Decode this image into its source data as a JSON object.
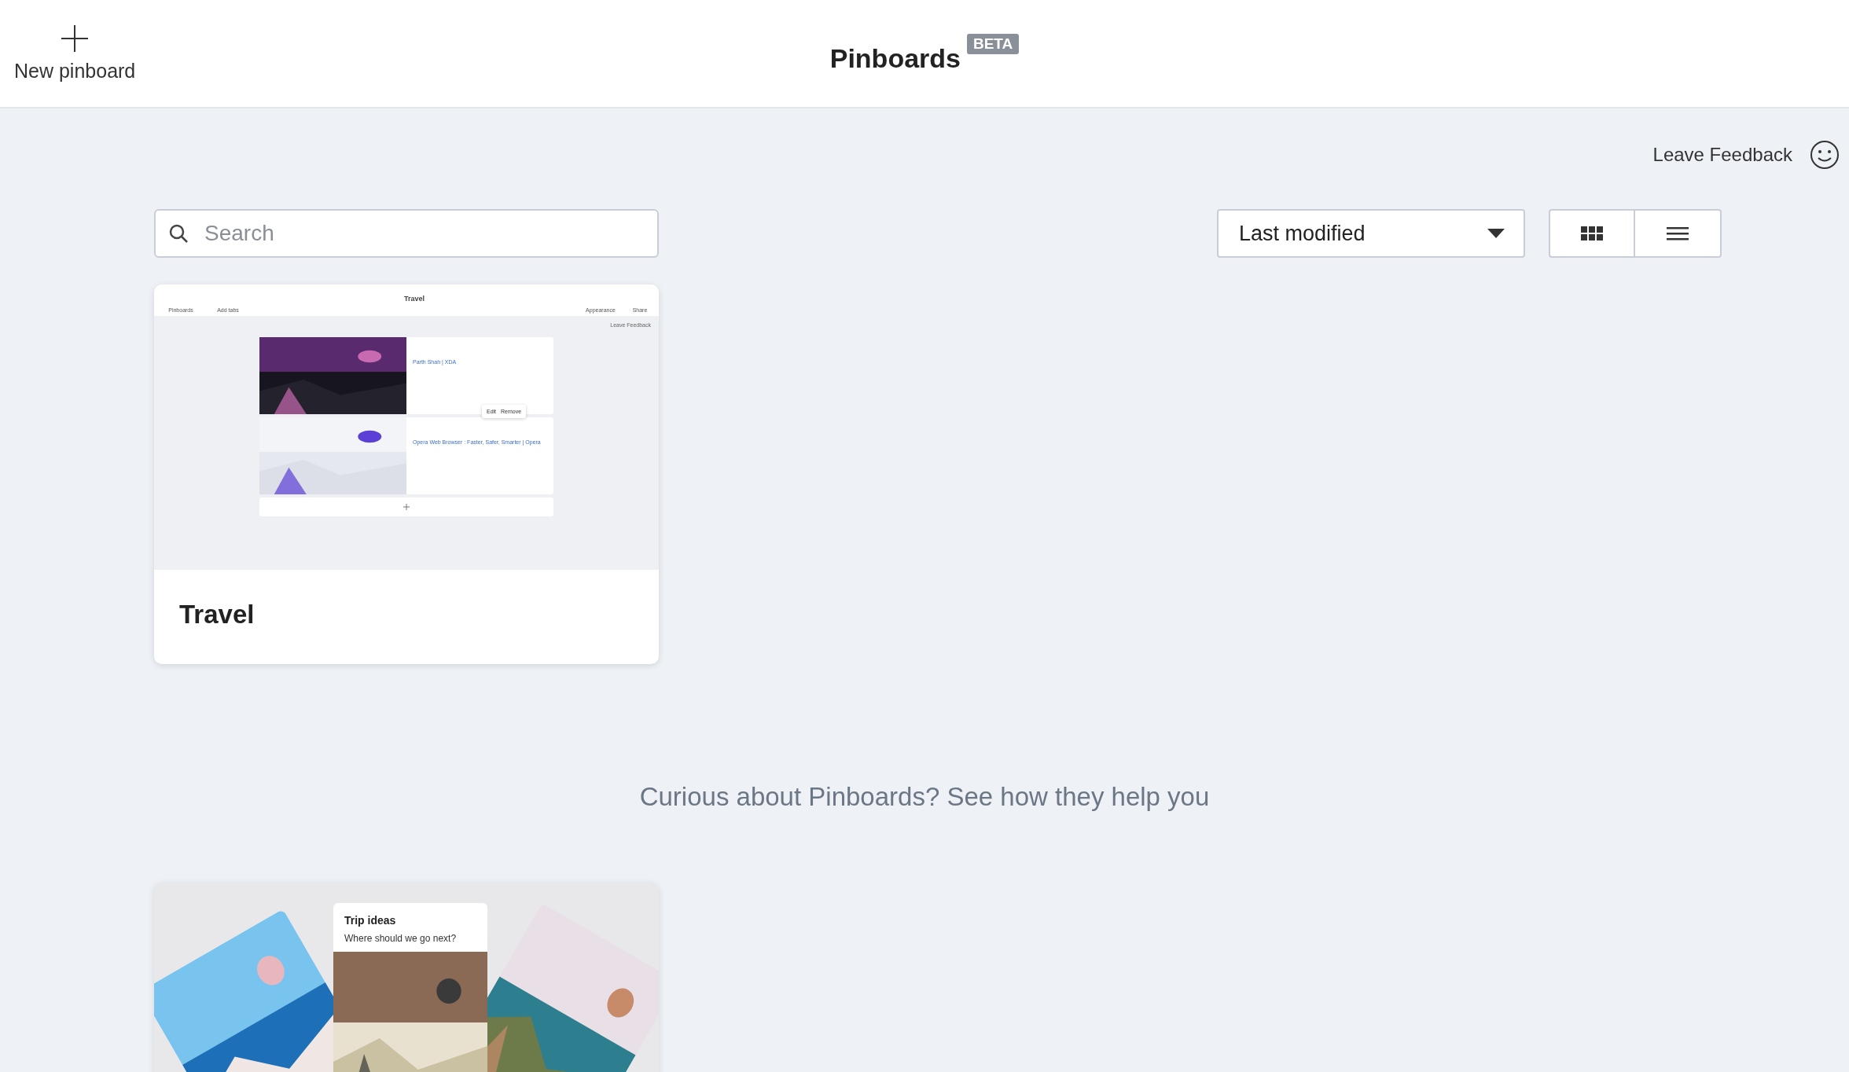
{
  "header": {
    "new_button": "New pinboard",
    "title": "Pinboards",
    "badge": "BETA"
  },
  "feedback": "Leave Feedback",
  "toolbar": {
    "search": {
      "placeholder": "Search"
    },
    "sort": {
      "value": "Last modified"
    }
  },
  "pinboards": [
    {
      "title": "Travel",
      "preview": {
        "back_label": "Pinboards",
        "add_label": "Add tabs",
        "title": "Travel",
        "appearance_label": "Appearance",
        "share_label": "Share",
        "feedback": "Leave Feedback",
        "tabs": [
          {
            "title": "Parth Shah | XDA"
          },
          {
            "title": "Opera Web Browser : Faster, Safer, Smarter | Opera"
          }
        ],
        "menu": [
          "Edit",
          "Remove"
        ]
      }
    }
  ],
  "promo": {
    "heading": "Curious about Pinboards? See how they help you",
    "card": {
      "title": "Trip ideas",
      "subtitle": "Where should we go next?"
    }
  }
}
